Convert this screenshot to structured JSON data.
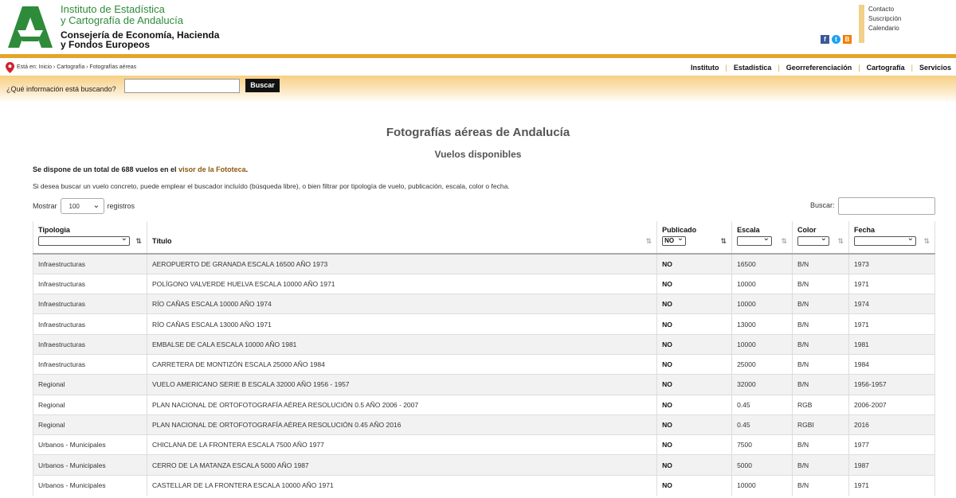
{
  "header": {
    "org_line1": "Instituto de Estadística",
    "org_line2": "y Cartografía de Andalucía",
    "org_line3": "Consejería de Economía, Hacienda",
    "org_line4": "y Fondos Europeos",
    "top_links": [
      "Contacto",
      "Suscripción",
      "Calendario"
    ],
    "social_icons": [
      "facebook-icon",
      "twitter-icon",
      "blog-icon"
    ]
  },
  "breadcrumb": "Está en: Inicio › Cartografía › Fotografías aéreas",
  "nav": [
    "Instituto",
    "Estadística",
    "Georreferenciación",
    "Cartografía",
    "Servicios"
  ],
  "search": {
    "label": "¿Qué información está buscando?",
    "value": "",
    "button": "Buscar"
  },
  "main": {
    "title": "Fotografías aéreas de Andalucía",
    "subtitle": "Vuelos disponibles",
    "intro_prefix": "Se dispone de un total de 688 vuelos en el ",
    "intro_link": "visor de la Fototeca",
    "intro_suffix": ".",
    "intro2": "Si desea buscar un vuelo concreto, puede emplear el buscador incluído (búsqueda libre), o bien filtrar por tipología de vuelo, publicación, escala, color o fecha.",
    "show_label": "Mostrar",
    "show_value": "100",
    "show_suffix": "registros",
    "buscar_label": "Buscar:",
    "buscar_value": ""
  },
  "table": {
    "headers": {
      "tipologia": "Tipologia",
      "titulo": "Título",
      "publicado": "Publicado",
      "escala": "Escala",
      "color": "Color",
      "fecha": "Fecha"
    },
    "filters": {
      "tipologia": "",
      "publicado": "NO",
      "escala": "",
      "color": "",
      "fecha": ""
    },
    "rows": [
      [
        "Infraestructuras",
        "AEROPUERTO DE GRANADA ESCALA 16500 AÑO 1973",
        "NO",
        "16500",
        "B/N",
        "1973"
      ],
      [
        "Infraestructuras",
        "POLÍGONO VALVERDE HUELVA ESCALA 10000 AÑO 1971",
        "NO",
        "10000",
        "B/N",
        "1971"
      ],
      [
        "Infraestructuras",
        "RÍO CAÑAS ESCALA 10000 AÑO 1974",
        "NO",
        "10000",
        "B/N",
        "1974"
      ],
      [
        "Infraestructuras",
        "RÍO CAÑAS ESCALA 13000 AÑO 1971",
        "NO",
        "13000",
        "B/N",
        "1971"
      ],
      [
        "Infraestructuras",
        "EMBALSE DE CALA ESCALA 10000 AÑO 1981",
        "NO",
        "10000",
        "B/N",
        "1981"
      ],
      [
        "Infraestructuras",
        "CARRETERA DE MONTIZÓN ESCALA 25000 AÑO 1984",
        "NO",
        "25000",
        "B/N",
        "1984"
      ],
      [
        "Regional",
        "VUELO AMERICANO SERIE B ESCALA 32000 AÑO 1956 - 1957",
        "NO",
        "32000",
        "B/N",
        "1956-1957"
      ],
      [
        "Regional",
        "PLAN NACIONAL DE ORTOFOTOGRAFÍA AÉREA RESOLUCIÓN 0.5 AÑO 2006 - 2007",
        "NO",
        "0.45",
        "RGB",
        "2006-2007"
      ],
      [
        "Regional",
        "PLAN NACIONAL DE ORTOFOTOGRAFÍA AÉREA RESOLUCIÓN 0.45 AÑO 2016",
        "NO",
        "0.45",
        "RGBI",
        "2016"
      ],
      [
        "Urbanos - Municipales",
        "CHICLANA DE LA FRONTERA ESCALA 7500 AÑO 1977",
        "NO",
        "7500",
        "B/N",
        "1977"
      ],
      [
        "Urbanos - Municipales",
        "CERRO DE LA MATANZA ESCALA 5000 AÑO 1987",
        "NO",
        "5000",
        "B/N",
        "1987"
      ],
      [
        "Urbanos - Municipales",
        "CASTELLAR DE LA FRONTERA ESCALA 10000 AÑO 1971",
        "NO",
        "10000",
        "B/N",
        "1971"
      ]
    ]
  },
  "colors": {
    "brand_green": "#2e8b3a",
    "gold": "#e2a52a",
    "link_brown": "#8b5a10"
  }
}
